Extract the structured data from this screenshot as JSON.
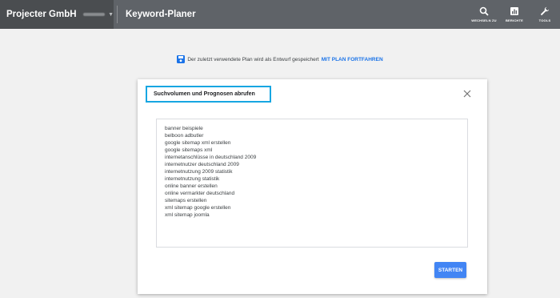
{
  "topbar": {
    "account_name": "Projecter GmbH",
    "app_title": "Keyword-Planer",
    "tools": [
      {
        "label": "WECHSELN ZU",
        "icon": "search-icon"
      },
      {
        "label": "BERICHTE",
        "icon": "reports-icon"
      },
      {
        "label": "TOOLS",
        "icon": "wrench-icon"
      }
    ]
  },
  "draft_bar": {
    "message": "Der zuletzt verwendete Plan wird als Entwurf gespeichert",
    "link": "MIT PLAN FORTFAHREN",
    "icon": "save-icon"
  },
  "dialog": {
    "title": "Suchvolumen und Prognosen abrufen",
    "close_icon": "close-icon",
    "keywords": [
      "banner beispiele",
      "belboon adbutler",
      "google sitemap xml erstellen",
      "google sitemaps xml",
      "internetanschlüsse in deutschland 2009",
      "internetnutzer deutschland 2009",
      "internetnutzung 2009 statistik",
      "internetnutzung statistik",
      "online banner erstellen",
      "online vermarkter deutschland",
      "sitemaps erstellen",
      "xml sitemap google erstellen",
      "xml sitemap joomla"
    ],
    "start_button": "STARTEN"
  },
  "colors": {
    "topbar": "#5f6368",
    "accent_blue": "#4285f4",
    "link_blue": "#1a73e8",
    "highlight_border": "#17a6e2"
  }
}
